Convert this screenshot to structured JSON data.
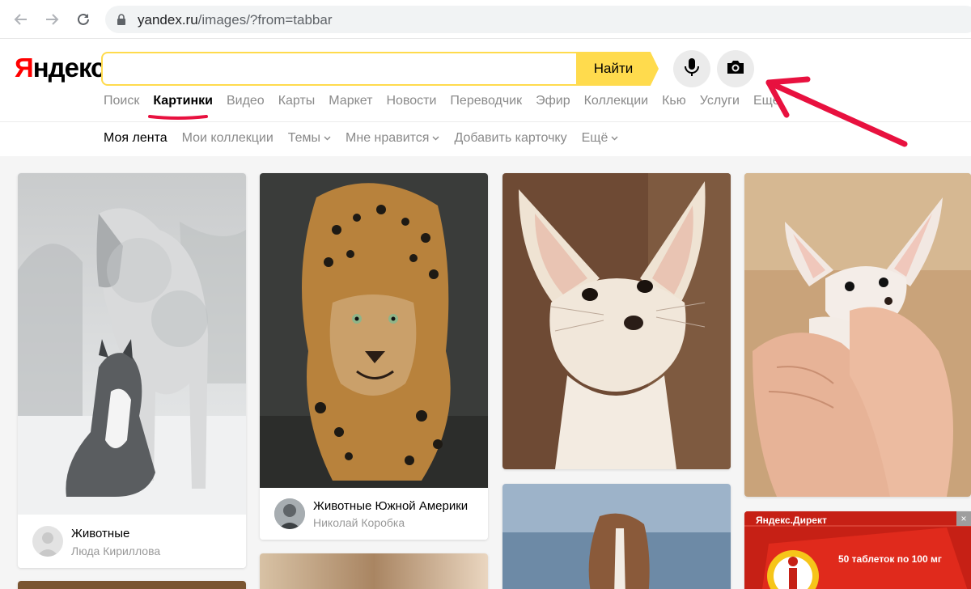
{
  "browser": {
    "url_host": "yandex.ru",
    "url_path": "/images/?from=tabbar",
    "icons": [
      "back-arrow-icon",
      "forward-arrow-icon",
      "reload-icon",
      "lock-icon"
    ]
  },
  "header": {
    "logo": {
      "first_letter": "Я",
      "rest": "ндекс"
    },
    "search": {
      "value": "",
      "placeholder": "",
      "button_label": "Найти"
    },
    "voice_icon": "microphone-icon",
    "image_search_icon": "camera-icon",
    "services": [
      {
        "label": "Поиск",
        "active": false
      },
      {
        "label": "Картинки",
        "active": true
      },
      {
        "label": "Видео",
        "active": false
      },
      {
        "label": "Карты",
        "active": false
      },
      {
        "label": "Маркет",
        "active": false
      },
      {
        "label": "Новости",
        "active": false
      },
      {
        "label": "Переводчик",
        "active": false
      },
      {
        "label": "Эфир",
        "active": false
      },
      {
        "label": "Коллекции",
        "active": false
      },
      {
        "label": "Кью",
        "active": false
      },
      {
        "label": "Услуги",
        "active": false
      },
      {
        "label": "Ещё",
        "active": false
      }
    ]
  },
  "subnav": [
    {
      "label": "Моя лента",
      "active": true,
      "dropdown": false
    },
    {
      "label": "Мои коллекции",
      "active": false,
      "dropdown": false
    },
    {
      "label": "Темы",
      "active": false,
      "dropdown": true
    },
    {
      "label": "Мне нравится",
      "active": false,
      "dropdown": true
    },
    {
      "label": "Добавить карточку",
      "active": false,
      "dropdown": false
    },
    {
      "label": "Ещё",
      "active": false,
      "dropdown": true
    }
  ],
  "cards": [
    {
      "image": "horse and husky in snow",
      "title": "Животные",
      "author": "Люда Кириллова"
    },
    {
      "image": "jaguar walking",
      "title": "Животные Южной Америки",
      "author": "Николай Коробка"
    },
    {
      "image": "fennec fox",
      "title": "",
      "author": ""
    },
    {
      "image": "fennec fox in hands",
      "title": "",
      "author": ""
    }
  ],
  "ad": {
    "label": "Яндекс.Директ",
    "text": "50 таблеток по 100 мг",
    "close": "×"
  },
  "colors": {
    "yandex_red": "#ff0000",
    "search_yellow": "#ffdb4d",
    "annotation_red": "#e8113f"
  }
}
